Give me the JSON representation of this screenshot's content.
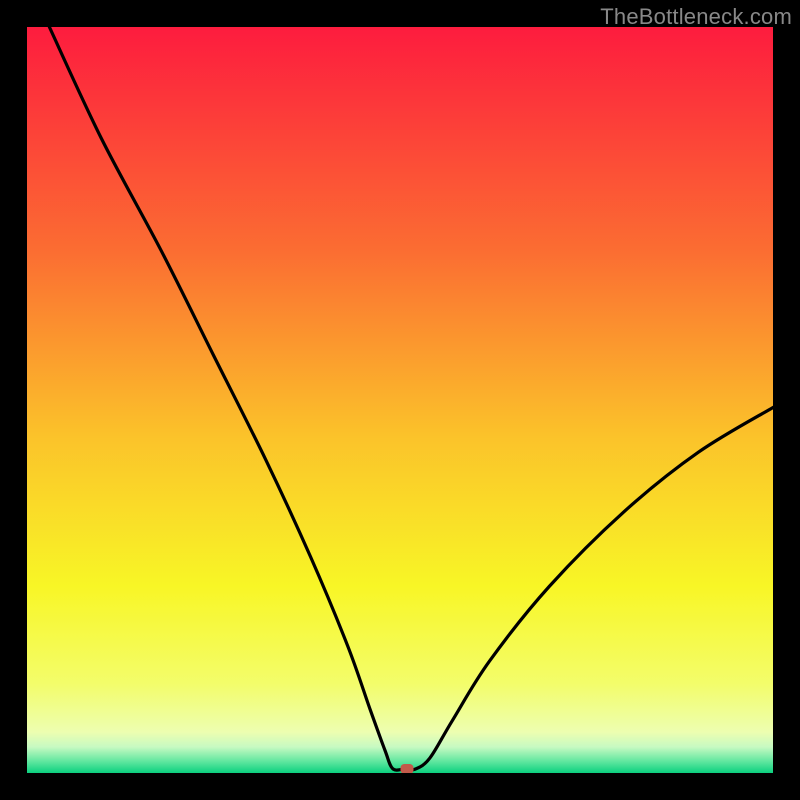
{
  "watermark": "TheBottleneck.com",
  "chart_data": {
    "type": "line",
    "title": "",
    "xlabel": "",
    "ylabel": "",
    "xlim": [
      0,
      100
    ],
    "ylim": [
      0,
      100
    ],
    "gradient_stops": [
      {
        "offset": 0,
        "color": "#fd1c3e"
      },
      {
        "offset": 0.3,
        "color": "#fb6d32"
      },
      {
        "offset": 0.55,
        "color": "#fbc32a"
      },
      {
        "offset": 0.75,
        "color": "#f8f626"
      },
      {
        "offset": 0.88,
        "color": "#f3fd6a"
      },
      {
        "offset": 0.945,
        "color": "#edfeb0"
      },
      {
        "offset": 0.965,
        "color": "#c7fac2"
      },
      {
        "offset": 0.985,
        "color": "#5de69e"
      },
      {
        "offset": 1.0,
        "color": "#0bd07f"
      }
    ],
    "series": [
      {
        "name": "bottleneck-curve",
        "x": [
          3,
          10,
          18,
          25,
          32,
          38,
          43,
          46,
          48,
          49,
          50.5,
          52,
          54,
          57,
          62,
          70,
          80,
          90,
          100
        ],
        "y": [
          100,
          85,
          70,
          56,
          42,
          29,
          17,
          8.5,
          3,
          0.6,
          0.5,
          0.5,
          2,
          7,
          15,
          25,
          35,
          43,
          49
        ]
      }
    ],
    "marker": {
      "x": 51,
      "y": 0.5,
      "color": "#c25a4a"
    },
    "annotations": []
  }
}
